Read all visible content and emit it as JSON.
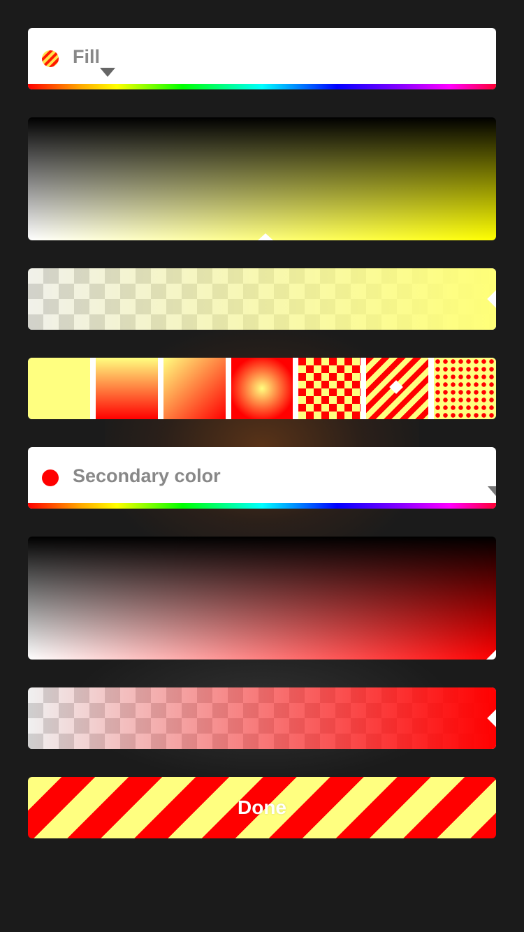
{
  "primary": {
    "label": "Fill",
    "color": "#ffff00"
  },
  "styles": [
    {
      "name": "solid"
    },
    {
      "name": "linear-gradient"
    },
    {
      "name": "diagonal-gradient"
    },
    {
      "name": "radial-gradient"
    },
    {
      "name": "checker-pattern"
    },
    {
      "name": "stripes-pattern",
      "selected": true
    },
    {
      "name": "dots-pattern"
    }
  ],
  "secondary": {
    "label": "Secondary color",
    "color": "#ff0000"
  },
  "done_label": "Done",
  "colors": {
    "background": "#1b1b1b",
    "primary_swatch": "#ffff80",
    "secondary_swatch": "#ff0000"
  }
}
